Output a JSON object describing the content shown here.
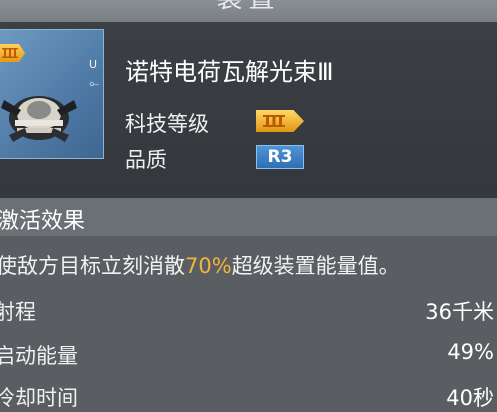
{
  "header": {
    "title": "装置"
  },
  "item": {
    "name": "诺特电荷瓦解光束Ⅲ",
    "thumb_badge_icon": "tier-3-chevron-icon",
    "thumb_u": "U",
    "thumb_link_icon": "link-icon",
    "tech_level_label": "科技等级",
    "tech_level_icon": "tier-3-chevron-icon",
    "quality_label": "品质",
    "quality_value": "R3"
  },
  "effect": {
    "section_title": "激活效果",
    "desc_before": "使敌方目标立刻消散",
    "desc_highlight": "70%",
    "desc_after": "超级装置能量值。"
  },
  "stats": [
    {
      "label": "射程",
      "value": "36千米"
    },
    {
      "label": "启动能量",
      "value": "49%"
    },
    {
      "label": "冷却时间",
      "value": "40秒"
    }
  ],
  "colors": {
    "highlight": "#f0b43c",
    "tier_badge": "#e9a62a",
    "quality_badge": "#3f82c6"
  }
}
